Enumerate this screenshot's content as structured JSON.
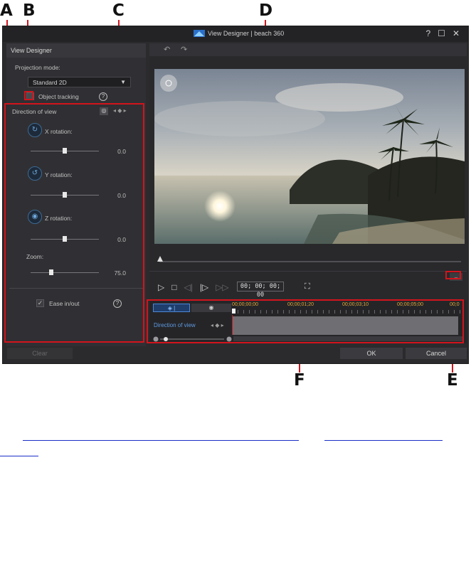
{
  "callouts": {
    "a": "A",
    "b": "B",
    "c": "C",
    "d": "D",
    "e": "E",
    "f": "F"
  },
  "window": {
    "title": "View Designer  |  beach 360",
    "help": "?",
    "maximize": "☐",
    "close": "✕"
  },
  "left_panel": {
    "header": "View Designer",
    "projection_label": "Projection mode:",
    "projection_value": "Standard 2D",
    "object_tracking": "Object tracking",
    "help": "?",
    "direction_label": "Direction of view",
    "x_label": "X rotation:",
    "x_value": "0.0",
    "x_level": 0.5,
    "y_label": "Y rotation:",
    "y_value": "0.0",
    "y_level": 0.5,
    "z_label": "Z rotation:",
    "z_value": "0.0",
    "z_level": 0.5,
    "zoom_label": "Zoom:",
    "zoom_value": "75.0",
    "zoom_level": 0.3,
    "ease_label": "Ease in/out",
    "ease_check": "✓"
  },
  "preview": {
    "undo": "↶",
    "redo": "↷",
    "timecode": "00; 00; 00; 00",
    "play": "▷",
    "stop": "□",
    "prev_frame": "◁|",
    "next_frame": "|▷",
    "next_keyframe": "▷▷",
    "fullscreen": "⛶",
    "expand": "⌄",
    "nav_icon": "✥"
  },
  "timeline": {
    "ticks": [
      "00;00;00;00",
      "00;00;01;20",
      "00;00;03;10",
      "00;00;05;00",
      "00;0"
    ],
    "track_label": "Direction of view",
    "track_kf": "◂ ◆ ▸",
    "tab1": "◈ |",
    "tab2": "◉"
  },
  "footer": {
    "clear": "Clear",
    "ok": "OK",
    "cancel": "Cancel"
  },
  "colors": {
    "highlight": "#d3141c",
    "accent": "#5f9be0",
    "ruler": "#e0a83a"
  }
}
